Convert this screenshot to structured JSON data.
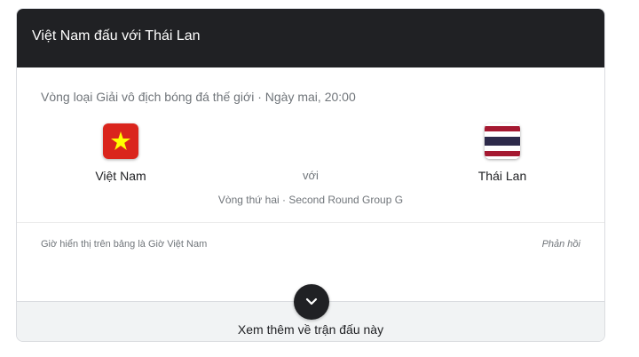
{
  "header": {
    "title": "Việt Nam đấu với Thái Lan"
  },
  "match": {
    "subtitle": "Vòng loại Giải vô địch bóng đá thế giới · Ngày mai, 20:00",
    "home": {
      "name": "Việt Nam",
      "flag_icon": "vietnam-flag-icon"
    },
    "away": {
      "name": "Thái Lan",
      "flag_icon": "thailand-flag-icon"
    },
    "vs": "với",
    "round": "Vòng thứ hai · Second Round Group G"
  },
  "footer": {
    "timezone_note": "Giờ hiển thị trên bảng là Giờ Việt Nam",
    "feedback": "Phản hồi",
    "more": "Xem thêm về trận đấu này",
    "expand_icon": "chevron-down-icon"
  },
  "colors": {
    "header_bg": "#202124",
    "vn_red": "#da251d",
    "vn_star": "#ffff00",
    "th_red": "#a51931",
    "th_blue": "#2d2a4a"
  }
}
